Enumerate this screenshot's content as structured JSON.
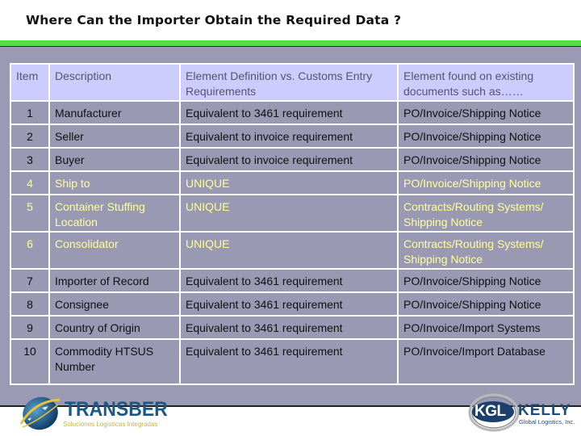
{
  "slide": {
    "title": "Where Can the Importer Obtain the Required Data ?"
  },
  "colors": {
    "accent_bar": "#55dd4c",
    "band": "#9a9ab4",
    "header_bg": "#ccccff",
    "cell_bg": "#9999b3",
    "highlight_text": "#ffff99"
  },
  "table": {
    "headers": [
      "Item",
      "Description",
      "Element Definition vs. Customs Entry Requirements",
      "Element found on existing documents such as……"
    ],
    "rows": [
      {
        "item": "1",
        "description": "Manufacturer",
        "definition": "Equivalent to 3461 requirement",
        "documents": "PO/Invoice/Shipping Notice",
        "highlight": false
      },
      {
        "item": "2",
        "description": "Seller",
        "definition": "Equivalent to invoice requirement",
        "documents": "PO/Invoice/Shipping Notice",
        "highlight": false
      },
      {
        "item": "3",
        "description": "Buyer",
        "definition": "Equivalent to invoice requirement",
        "documents": "PO/Invoice/Shipping Notice",
        "highlight": false
      },
      {
        "item": "4",
        "description": "Ship to",
        "definition": "UNIQUE",
        "documents": "PO/Invoice/Shipping Notice",
        "highlight": true
      },
      {
        "item": "5",
        "description": "Container Stuffing Location",
        "definition": "UNIQUE",
        "documents": "Contracts/Routing Systems/ Shipping Notice",
        "highlight": true
      },
      {
        "item": "6",
        "description": "Consolidator",
        "definition": "UNIQUE",
        "documents": "Contracts/Routing Systems/ Shipping Notice",
        "highlight": true
      },
      {
        "item": "7",
        "description": "Importer of Record",
        "definition": "Equivalent to 3461 requirement",
        "documents": "PO/Invoice/Shipping Notice",
        "highlight": false
      },
      {
        "item": "8",
        "description": "Consignee",
        "definition": "Equivalent to 3461 requirement",
        "documents": "PO/Invoice/Shipping Notice",
        "highlight": false
      },
      {
        "item": "9",
        "description": "Country of Origin",
        "definition": "Equivalent to 3461 requirement",
        "documents": "PO/Invoice/Import Systems",
        "highlight": false
      },
      {
        "item": "10",
        "description": "Commodity HTSUS Number",
        "definition": "Equivalent to 3461 requirement",
        "documents": "PO/Invoice/Import Database",
        "highlight": false
      }
    ]
  },
  "logos": {
    "left": {
      "name": "TRANSBER",
      "tagline": "Soluciones Logísticas Integradas",
      "icon": "globe-swoosh-icon"
    },
    "right": {
      "badge": "KGL",
      "name": "KELLY",
      "tagline": "Global Logistics, Inc.",
      "icon": "ring-swoosh-icon"
    }
  }
}
